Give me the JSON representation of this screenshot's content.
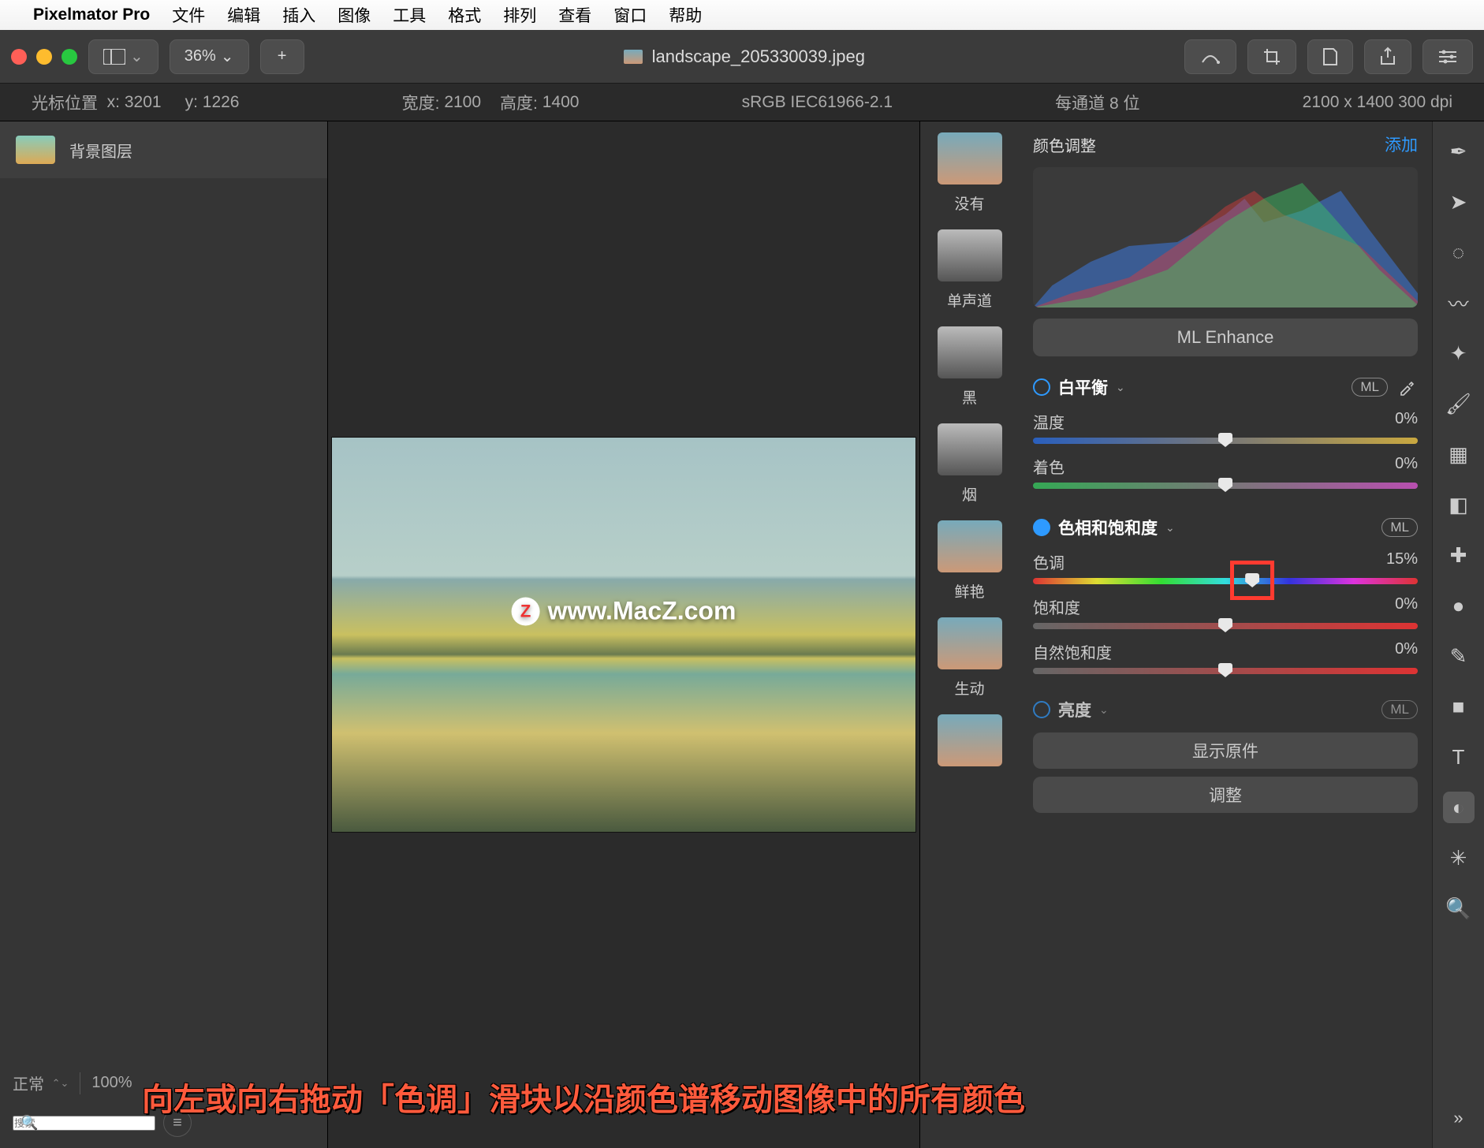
{
  "menubar": {
    "app": "Pixelmator Pro",
    "items": [
      "文件",
      "编辑",
      "插入",
      "图像",
      "工具",
      "格式",
      "排列",
      "查看",
      "窗口",
      "帮助"
    ]
  },
  "toolbar": {
    "zoom": "36%",
    "title": "landscape_205330039.jpeg"
  },
  "status": {
    "cursor_label": "光标位置",
    "x_label": "x:",
    "x": "3201",
    "y_label": "y:",
    "y": "1226",
    "w_label": "宽度:",
    "w": "2100",
    "h_label": "高度:",
    "h": "1400",
    "colorspace": "sRGB IEC61966-2.1",
    "depth": "每通道 8 位",
    "dims": "2100 x 1400 300 dpi"
  },
  "layers": {
    "bg": "背景图层",
    "blend": "正常",
    "opacity": "100%",
    "search_ph": "搜索"
  },
  "watermark": "www.MacZ.com",
  "presets": {
    "none": "没有",
    "mono": "单声道",
    "black": "黑",
    "smoke": "烟",
    "vivid": "鲜艳",
    "vibrant": "生动"
  },
  "adjust": {
    "title": "颜色调整",
    "add": "添加",
    "ml": "ML Enhance",
    "wb": {
      "name": "白平衡",
      "ml": "ML",
      "temp_l": "温度",
      "temp_v": "0%",
      "tint_l": "着色",
      "tint_v": "0%"
    },
    "hs": {
      "name": "色相和饱和度",
      "ml": "ML",
      "hue_l": "色调",
      "hue_v": "15%",
      "sat_l": "饱和度",
      "sat_v": "0%",
      "vib_l": "自然饱和度",
      "vib_v": "0%"
    },
    "bright": {
      "name": "亮度",
      "ml": "ML"
    },
    "show_orig": "显示原件",
    "apply": "调整"
  },
  "caption": "向左或向右拖动「色调」滑块以沿颜色谱移动图像中的所有颜色"
}
